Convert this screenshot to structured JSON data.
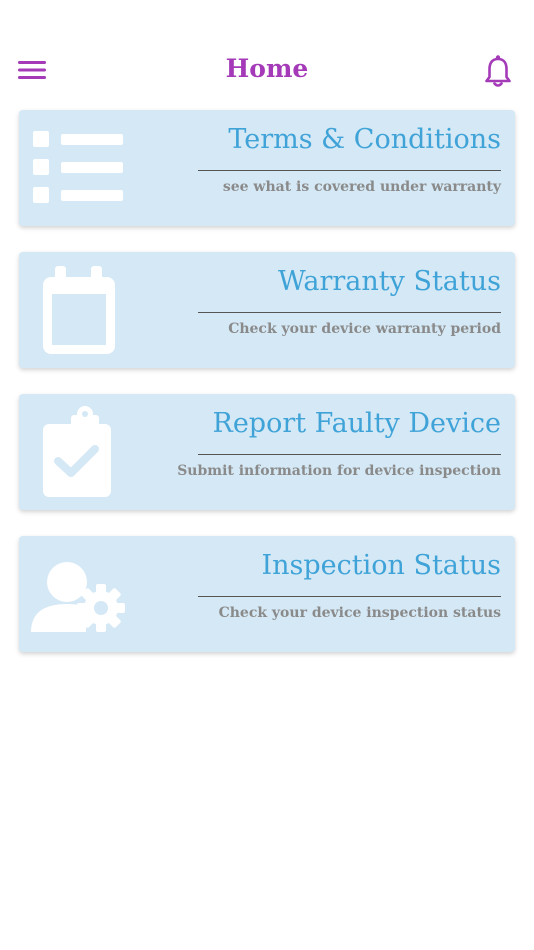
{
  "header": {
    "title": "Home",
    "menu_icon": "hamburger-menu-icon",
    "notification_icon": "bell-icon"
  },
  "colors": {
    "accent": "#a43ab8",
    "card_bg": "#d4e8f5",
    "card_title": "#3fa3d8",
    "card_subtitle": "#8a8a8a",
    "icon_fill": "#ffffff"
  },
  "cards": [
    {
      "title": "Terms & Conditions",
      "subtitle": "see what is covered under warranty",
      "icon": "list-icon"
    },
    {
      "title": "Warranty Status",
      "subtitle": "Check your device warranty period",
      "icon": "calendar-icon"
    },
    {
      "title": "Report Faulty Device",
      "subtitle": "Submit information for device inspection",
      "icon": "clipboard-check-icon"
    },
    {
      "title": "Inspection Status",
      "subtitle": "Check your device inspection status",
      "icon": "user-gear-icon"
    }
  ]
}
